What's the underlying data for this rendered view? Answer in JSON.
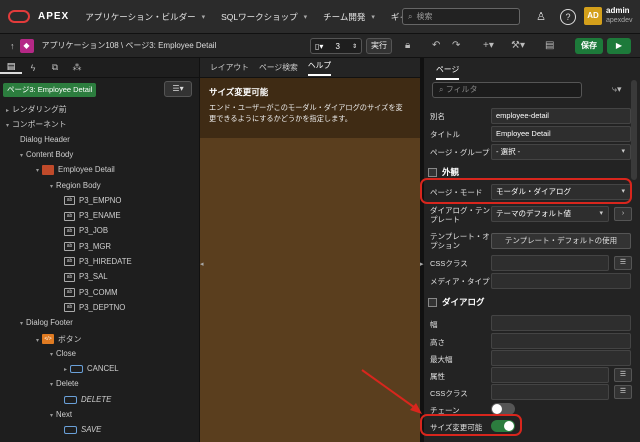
{
  "topbar": {
    "brand": "APEX",
    "menus": [
      "アプリケーション・ビルダー",
      "SQLワークショップ",
      "チーム開発",
      "ギャラリ"
    ],
    "search_placeholder": "検索",
    "avatar": "AD",
    "user_name": "admin",
    "workspace": "apexdev"
  },
  "toolbar": {
    "breadcrumb": "アプリケーション108 \\ ページ3: Employee Detail",
    "page_number": "3",
    "run_label": "実行",
    "save_label": "保存"
  },
  "left": {
    "page_badge": "ページ3: Employee Detail",
    "tree": [
      {
        "label": "レンダリング前",
        "depth": 0,
        "arrow": "▸",
        "icon": "none"
      },
      {
        "label": "コンポーネント",
        "depth": 0,
        "arrow": "▾",
        "icon": "none"
      },
      {
        "label": "Dialog Header",
        "depth": 1,
        "arrow": "",
        "icon": "none"
      },
      {
        "label": "Content Body",
        "depth": 1,
        "arrow": "▾",
        "icon": "none"
      },
      {
        "label": "Employee Detail",
        "depth": 2,
        "arrow": "▾",
        "icon": "region"
      },
      {
        "label": "Region Body",
        "depth": 3,
        "arrow": "▾",
        "icon": "none"
      },
      {
        "label": "P3_EMPNO",
        "depth": 4,
        "arrow": "",
        "icon": "field"
      },
      {
        "label": "P3_ENAME",
        "depth": 4,
        "arrow": "",
        "icon": "field"
      },
      {
        "label": "P3_JOB",
        "depth": 4,
        "arrow": "",
        "icon": "field"
      },
      {
        "label": "P3_MGR",
        "depth": 4,
        "arrow": "",
        "icon": "field"
      },
      {
        "label": "P3_HIREDATE",
        "depth": 4,
        "arrow": "",
        "icon": "field"
      },
      {
        "label": "P3_SAL",
        "depth": 4,
        "arrow": "",
        "icon": "field"
      },
      {
        "label": "P3_COMM",
        "depth": 4,
        "arrow": "",
        "icon": "field"
      },
      {
        "label": "P3_DEPTNO",
        "depth": 4,
        "arrow": "",
        "icon": "field"
      },
      {
        "label": "Dialog Footer",
        "depth": 1,
        "arrow": "▾",
        "icon": "none"
      },
      {
        "label": "ボタン",
        "depth": 2,
        "arrow": "▾",
        "icon": "code"
      },
      {
        "label": "Close",
        "depth": 3,
        "arrow": "▾",
        "icon": "none"
      },
      {
        "label": "CANCEL",
        "depth": 4,
        "arrow": "▸",
        "icon": "button"
      },
      {
        "label": "Delete",
        "depth": 3,
        "arrow": "▾",
        "icon": "none"
      },
      {
        "label": "DELETE",
        "depth": 4,
        "arrow": "",
        "icon": "button-italic"
      },
      {
        "label": "Next",
        "depth": 3,
        "arrow": "▾",
        "icon": "none"
      },
      {
        "label": "SAVE",
        "depth": 4,
        "arrow": "",
        "icon": "button-italic"
      }
    ]
  },
  "middle": {
    "tabs": [
      "レイアウト",
      "ページ検索",
      "ヘルプ"
    ],
    "help_title": "サイズ変更可能",
    "help_text": "エンド・ユーザーがこのモーダル・ダイアログのサイズを変更できるようにするかどうかを指定します。"
  },
  "right": {
    "tab": "ページ",
    "filter_placeholder": "フィルタ",
    "alias_label": "別名",
    "alias_value": "employee-detail",
    "title_label": "タイトル",
    "title_value": "Employee Detail",
    "group_label": "ページ・グループ",
    "group_value": "- 選択 -",
    "appearance_section": "外観",
    "mode_label": "ページ・モード",
    "mode_value": "モーダル・ダイアログ",
    "dialog_template_label": "ダイアログ・テンプレート",
    "dialog_template_value": "テーマのデフォルト値",
    "template_options_label": "テンプレート・オプション",
    "template_options_button": "テンプレート・デフォルトの使用",
    "css_class_label": "CSSクラス",
    "media_type_label": "メディア・タイプ",
    "dialog_section": "ダイアログ",
    "width_label": "幅",
    "height_label": "高さ",
    "max_width_label": "最大幅",
    "attributes_label": "属性",
    "dialog_css_label": "CSSクラス",
    "chained_label": "チェーン",
    "resizable_label": "サイズ変更可能",
    "chained_on": false,
    "resizable_on": true,
    "highlight_color": "#d8261d",
    "toggle_on_color": "#2c7d3e"
  }
}
